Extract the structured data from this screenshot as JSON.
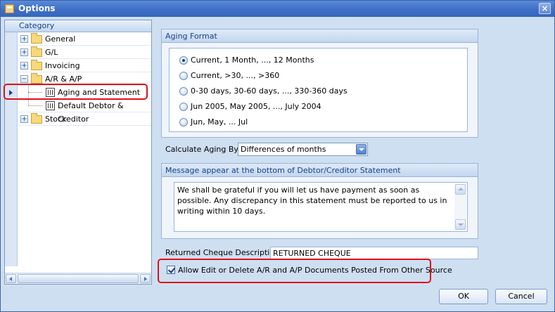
{
  "window": {
    "title": "Options",
    "icon": "options-app-icon",
    "close_glyph": "×"
  },
  "colors": {
    "accent": "#3f6fc6",
    "highlight_border": "#e0101a",
    "panel_bg": "#cfdff2"
  },
  "category_tree": {
    "header": "Category",
    "items": [
      {
        "label": "General",
        "expander": "+",
        "icon": "folder-icon"
      },
      {
        "label": "G/L",
        "expander": "+",
        "icon": "folder-icon"
      },
      {
        "label": "Invoicing",
        "expander": "+",
        "icon": "folder-icon"
      },
      {
        "label": "A/R & A/P",
        "expander": "−",
        "icon": "folder-icon"
      },
      {
        "label": "Aging and Statement",
        "icon": "report-icon",
        "selected": true
      },
      {
        "label": "Default Debtor & Creditor",
        "icon": "report-icon"
      },
      {
        "label": "Stock",
        "expander": "+",
        "icon": "folder-icon"
      }
    ]
  },
  "aging_format": {
    "title": "Aging Format",
    "options": [
      {
        "label": "Current, 1 Month, ..., 12 Months",
        "checked": true
      },
      {
        "label": "Current, >30, ..., >360",
        "checked": false
      },
      {
        "label": "0-30 days, 30-60 days, ..., 330-360 days",
        "checked": false
      },
      {
        "label": "Jun 2005, May 2005, ..., July 2004",
        "checked": false
      },
      {
        "label": "Jun, May, ... Jul",
        "checked": false
      }
    ]
  },
  "calculate_aging": {
    "label": "Calculate Aging By:",
    "value": "Differences of months"
  },
  "statement_message": {
    "title": "Message appear at the bottom of Debtor/Creditor Statement",
    "text": "We shall be grateful if you will let us have payment as soon as possible. Any discrepancy in this statement must be reported to us in writing within 10 days."
  },
  "returned_cheque": {
    "label": "Returned Cheque Description",
    "value": "RETURNED CHEQUE"
  },
  "allow_edit": {
    "label": "Allow Edit or Delete A/R and A/P Documents Posted From Other Source",
    "checked": true
  },
  "buttons": {
    "ok": "OK",
    "cancel": "Cancel"
  }
}
